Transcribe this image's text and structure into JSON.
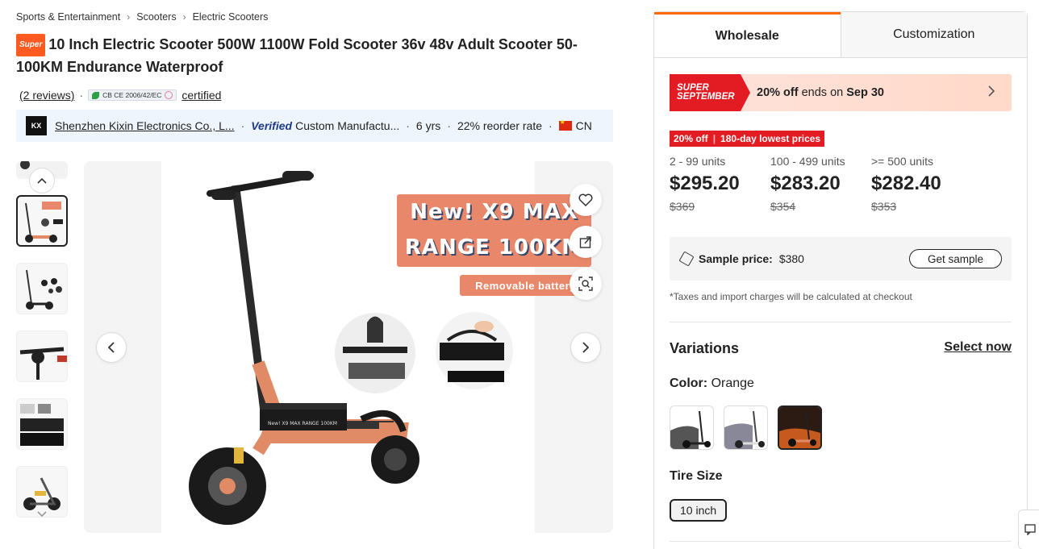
{
  "breadcrumb": [
    "Sports & Entertainment",
    "Scooters",
    "Electric Scooters"
  ],
  "product": {
    "badge": "Super",
    "title": "10 Inch Electric Scooter 500W 1100W Fold Scooter 36v 48v Adult Scooter 50-100KM Endurance Waterproof",
    "reviews": "(2 reviews)",
    "cert_text": "CB CE 2006/42/EC",
    "certified": "certified"
  },
  "supplier": {
    "logo": "KX",
    "name": "Shenzhen Kixin Electronics Co., L...",
    "verified": "Verified",
    "type": "Custom Manufactu...",
    "years": "6 yrs",
    "reorder": "22% reorder rate",
    "country": "CN"
  },
  "gallery": {
    "promo_line1": "New! X9 MAX",
    "promo_line2": "RANGE 100KM",
    "promo_sub": "Removable battery",
    "battery_text": "New! X9 MAX RANGE 100KM"
  },
  "tabs": [
    "Wholesale",
    "Customization"
  ],
  "deal": {
    "tag_line1": "SUPER",
    "tag_line2": "SEPTEMBER",
    "bold1": "20% off",
    "mid": " ends on ",
    "bold2": "Sep 30"
  },
  "discount_tag": {
    "pct": "20% off",
    "label": "180-day lowest prices"
  },
  "tiers": [
    {
      "range": "2 - 99 units",
      "price": "$295.20",
      "old": "$369"
    },
    {
      "range": "100 - 499 units",
      "price": "$283.20",
      "old": "$354"
    },
    {
      "range": ">= 500 units",
      "price": "$282.40",
      "old": "$353"
    }
  ],
  "sample": {
    "label": "Sample price:",
    "price": "$380",
    "button": "Get sample"
  },
  "tax_note": "*Taxes and import charges will be calculated at checkout",
  "variations": {
    "title": "Variations",
    "select_now": "Select now",
    "color_label": "Color:",
    "color_value": "Orange",
    "tire_label": "Tire Size",
    "tire_option": "10 inch"
  },
  "colors": {
    "accent": "#ff6a00",
    "deal_red": "#e31b23",
    "scooter_orange": "#e08a66"
  }
}
